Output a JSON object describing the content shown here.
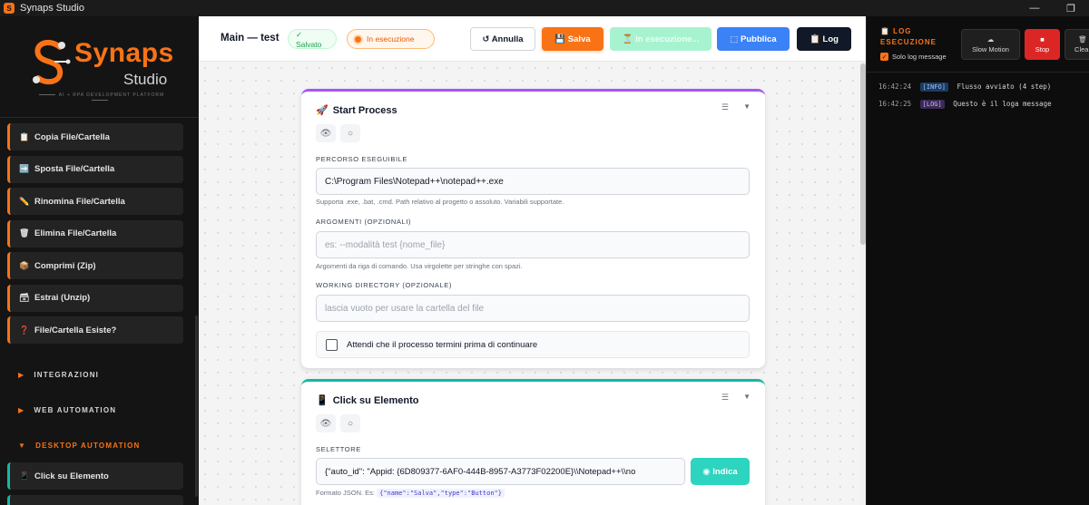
{
  "window": {
    "title": "Synaps Studio"
  },
  "brand": {
    "name": "Synaps",
    "sub": "Studio",
    "tagline": "AI + RPA DEVELOPMENT PLATFORM",
    "accent": "#f97316"
  },
  "sidebar": {
    "items": [
      {
        "label": "Copia File/Cartella",
        "icon": "clipboard-icon",
        "glyph": "📋"
      },
      {
        "label": "Sposta File/Cartella",
        "icon": "arrow-right-icon",
        "glyph": "➡️"
      },
      {
        "label": "Rinomina File/Cartella",
        "icon": "pencil-icon",
        "glyph": "✏️"
      },
      {
        "label": "Elimina File/Cartella",
        "icon": "trash-icon",
        "glyph": "🗑"
      },
      {
        "label": "Comprimi (Zip)",
        "icon": "package-icon",
        "glyph": "📦"
      },
      {
        "label": "Estrai (Unzip)",
        "icon": "box-icon",
        "glyph": "🗃"
      },
      {
        "label": "File/Cartella Esiste?",
        "icon": "question-icon",
        "glyph": "❓"
      }
    ],
    "sections": {
      "integrazioni": "INTEGRAZIONI",
      "web_automation": "WEB AUTOMATION",
      "desktop_automation": "DESKTOP AUTOMATION"
    },
    "desktop_items": [
      {
        "label": "Click su Elemento",
        "icon": "pointer-icon",
        "glyph": "📱"
      }
    ]
  },
  "header": {
    "title": "Main — test",
    "saved_badge": "✓ Salvato",
    "running_badge": "In esecuzione",
    "annulla": "↺ Annulla",
    "salva": "💾 Salva",
    "exec": "⏳ In esecuzione...",
    "pubblica": "⬚ Pubblica",
    "log": "📋 Log"
  },
  "start_card": {
    "title": "Start Process",
    "icon_glyph": "🚀",
    "path_label": "PERCORSO ESEGUIBILE",
    "path_value": "C:\\Program Files\\Notepad++\\notepad++.exe",
    "path_hint": "Supporta .exe, .bat, .cmd. Path relativo al progetto o assoluto. Variabili supportate.",
    "args_label": "ARGOMENTI (OPZIONALI)",
    "args_placeholder": "es: --modalità test {nome_file}",
    "args_hint": "Argomenti da riga di comando. Usa virgolette per stringhe con spazi.",
    "wd_label": "WORKING DIRECTORY (OPZIONALE)",
    "wd_placeholder": "lascia vuoto per usare la cartella del file",
    "wait_label": "Attendi che il processo termini prima di continuare"
  },
  "click_card": {
    "title": "Click su Elemento",
    "icon_glyph": "📱",
    "selector_label": "SELETTORE",
    "selector_value": "{\"auto_id\": \"Appid: {6D809377-6AF0-444B-8957-A3773F02200E}\\\\Notepad++\\\\no",
    "indica": "◉ Indica",
    "hint_prefix": "Formato JSON. Es:",
    "hint_code": "{\"name\":\"Salva\",\"type\":\"Button\"}"
  },
  "log_panel": {
    "title": "📋 LOG ESECUZIONE",
    "only_log": "Solo log message",
    "slow_icon": "☁",
    "slow_motion": "Slow Motion",
    "stop_icon": "■",
    "stop": "Stop",
    "clear_icon": "🗑",
    "clear": "Clear",
    "lines": [
      {
        "time": "16:42:24",
        "tag": "[INFO]",
        "kind": "info",
        "text": "Flusso avviato (4 step)"
      },
      {
        "time": "16:42:25",
        "tag": "[LOG]",
        "kind": "log",
        "text": "Questo è il loga message"
      }
    ]
  }
}
